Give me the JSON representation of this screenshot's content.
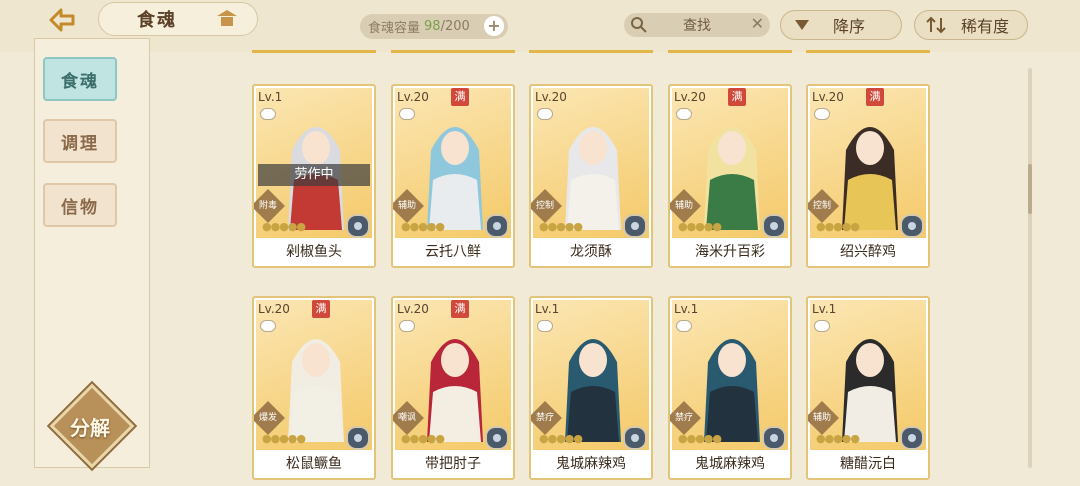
{
  "header": {
    "title": "食魂",
    "capacity_label": "食魂容量",
    "capacity_current": "98",
    "capacity_max": "/200",
    "capacity_add": "+",
    "search_text": "查找",
    "sort_order": "降序",
    "sort_by": "稀有度"
  },
  "sidebar": {
    "items": [
      {
        "label": "食魂",
        "active": true
      },
      {
        "label": "调理",
        "active": false
      },
      {
        "label": "信物",
        "active": false
      }
    ],
    "decompose_label": "分解"
  },
  "cards": [
    {
      "level": "Lv.1",
      "name": "剁椒鱼头",
      "role": "附毒",
      "full": false,
      "status": "劳作中",
      "hair": "#d9dbe0",
      "cloth": "#c23a33"
    },
    {
      "level": "Lv.20",
      "name": "云托八鲜",
      "role": "辅助",
      "full": true,
      "status": "",
      "hair": "#8fc8dd",
      "cloth": "#e9ecef"
    },
    {
      "level": "Lv.20",
      "name": "龙须酥",
      "role": "控制",
      "full": false,
      "status": "",
      "hair": "#e8e8ea",
      "cloth": "#f4f1ea"
    },
    {
      "level": "Lv.20",
      "name": "海米升百彩",
      "role": "辅助",
      "full": true,
      "status": "",
      "hair": "#f2e2a0",
      "cloth": "#3b7b45"
    },
    {
      "level": "Lv.20",
      "name": "绍兴醉鸡",
      "role": "控制",
      "full": true,
      "status": "",
      "hair": "#3b2d26",
      "cloth": "#e7c556"
    },
    {
      "level": "Lv.20",
      "name": "松鼠鳜鱼",
      "role": "爆发",
      "full": true,
      "status": "",
      "hair": "#f1ede2",
      "cloth": "#f2efe4"
    },
    {
      "level": "Lv.20",
      "name": "带把肘子",
      "role": "嘲讽",
      "full": true,
      "status": "",
      "hair": "#b9263a",
      "cloth": "#f3ede2"
    },
    {
      "level": "Lv.1",
      "name": "鬼城麻辣鸡",
      "role": "禁疗",
      "full": false,
      "status": "",
      "hair": "#2a5a6f",
      "cloth": "#22323f"
    },
    {
      "level": "Lv.1",
      "name": "鬼城麻辣鸡",
      "role": "禁疗",
      "full": false,
      "status": "",
      "hair": "#2a5a6f",
      "cloth": "#22323f"
    },
    {
      "level": "Lv.1",
      "name": "糖醋沅白",
      "role": "辅助",
      "full": false,
      "status": "",
      "hair": "#2b2b2b",
      "cloth": "#f1ede4"
    }
  ],
  "full_label": "满",
  "stars": "●●●●●",
  "colors": {
    "accent": "#e3c57a",
    "active_tab": "#bfe4e2",
    "capacity_current": "#7aa04a"
  }
}
